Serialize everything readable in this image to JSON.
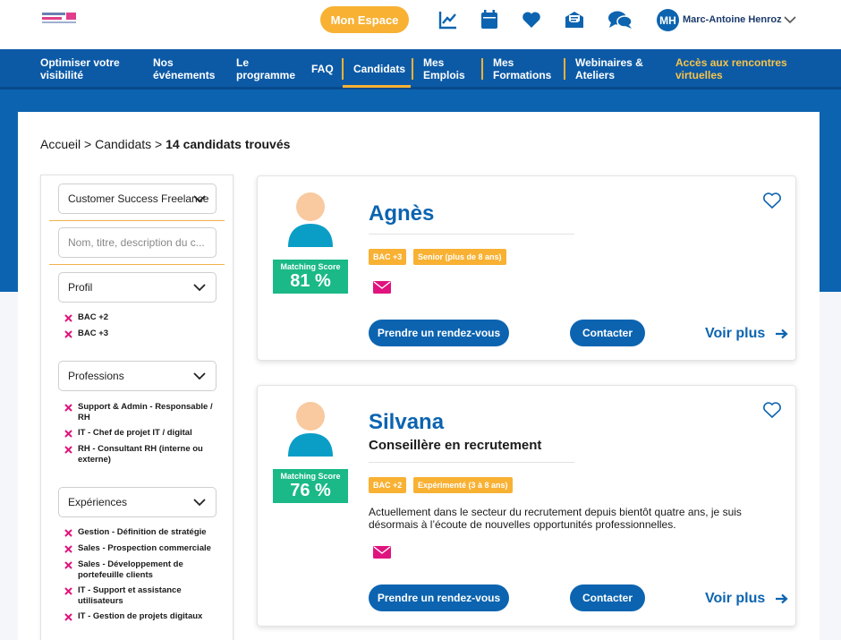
{
  "header": {
    "mon_espace_label": "Mon Espace",
    "user_initials": "MH",
    "user_name": "Marc-Antoine Henroz"
  },
  "nav": {
    "items": [
      {
        "label_l1": "Optimiser votre",
        "label_l2": "visibilité"
      },
      {
        "label_l1": "Nos",
        "label_l2": "événements"
      },
      {
        "label_l1": "Le",
        "label_l2": "programme"
      },
      {
        "label": "FAQ"
      },
      {
        "label": "Candidats"
      },
      {
        "label_l1": "Mes",
        "label_l2": "Emplois"
      },
      {
        "label_l1": "Mes",
        "label_l2": "Formations"
      },
      {
        "label_l1": "Webinaires &",
        "label_l2": "Ateliers"
      },
      {
        "label_l1": "Accès aux rencontres",
        "label_l2": "virtuelles"
      }
    ],
    "active_index": 4,
    "accent_color": "#f8b133"
  },
  "breadcrumb": {
    "home": "Accueil",
    "sep1": ">",
    "section": "Candidats",
    "sep2": ">",
    "current": "14 candidats trouvés"
  },
  "sidebar": {
    "job_select": "Customer Success Freelance",
    "search_placeholder": "Nom, titre, description du c...",
    "profil_label": "Profil",
    "profil_tags": [
      "BAC +2",
      "BAC +3"
    ],
    "professions_label": "Professions",
    "professions_tags": [
      [
        "Support & Admin - Responsable /",
        "RH"
      ],
      [
        "IT - Chef de projet IT / digital"
      ],
      [
        "RH - Consultant RH (interne ou",
        "externe)"
      ]
    ],
    "experiences_label": "Expériences",
    "experiences_tags": [
      [
        "Gestion - Définition de stratégie"
      ],
      [
        "Sales - Prospection commerciale"
      ],
      [
        "Sales - Développement de",
        "portefeuille clients"
      ],
      [
        "IT - Support et assistance",
        "utilisateurs"
      ],
      [
        "IT - Gestion de projets digitaux"
      ]
    ]
  },
  "candidates": [
    {
      "name": "Agnès",
      "title": "",
      "score_label": "Matching Score",
      "score": "81 %",
      "badges": [
        "BAC +3",
        "Senior (plus de 8 ans)"
      ],
      "description": "",
      "rdv_label": "Prendre un rendez-vous",
      "contact_label": "Contacter",
      "voir_label": "Voir plus"
    },
    {
      "name": "Silvana",
      "title": "Conseillère en recrutement",
      "score_label": "Matching Score",
      "score": "76 %",
      "badges": [
        "BAC +2",
        "Expérimenté (3 à 8 ans)"
      ],
      "description_l1": "Actuellement dans le secteur du recrutement depuis bientôt quatre ans, je suis",
      "description_l2": "désormais à l’écoute de nouvelles opportunités professionnelles.",
      "rdv_label": "Prendre un rendez-vous",
      "contact_label": "Contacter",
      "voir_label": "Voir plus"
    }
  ],
  "icons": {
    "stats": "chart-line-icon",
    "calendar": "calendar-icon",
    "favorites": "heart-icon",
    "mail": "mail-open-icon",
    "chat": "chat-bubbles-icon"
  },
  "colors": {
    "brand_blue": "#0c64b0",
    "nav_blue": "#0c5aa6",
    "accent_orange": "#f8b133",
    "score_green": "#1ab987",
    "mail_pink": "#e0147e"
  }
}
